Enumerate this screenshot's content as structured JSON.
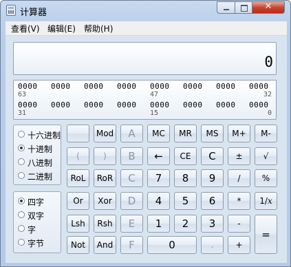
{
  "window": {
    "title": "计算器"
  },
  "menu": [
    "查看(V)",
    "编辑(E)",
    "帮助(H)"
  ],
  "display": {
    "value": "0"
  },
  "bits": {
    "rows": [
      [
        "0000",
        "0000",
        "0000",
        "0000",
        "0000",
        "0000",
        "0000",
        "0000"
      ],
      [
        "0000",
        "0000",
        "0000",
        "0000",
        "0000",
        "0000",
        "0000",
        "0000"
      ]
    ],
    "positions": [
      [
        "63",
        "47",
        "32"
      ],
      [
        "31",
        "15",
        "0"
      ]
    ]
  },
  "radix": {
    "options": [
      "十六进制",
      "十进制",
      "八进制",
      "二进制"
    ],
    "selected": 1
  },
  "word": {
    "options": [
      "四字",
      "双字",
      "字",
      "字节"
    ],
    "selected": 0
  },
  "keys": [
    [
      "",
      "Mod",
      "A",
      "MC",
      "MR",
      "MS",
      "M+",
      "M-"
    ],
    [
      "(",
      ")",
      "B",
      "←",
      "CE",
      "C",
      "±",
      "√"
    ],
    [
      "RoL",
      "RoR",
      "C",
      "7",
      "8",
      "9",
      "/",
      "%"
    ],
    [
      "Or",
      "Xor",
      "D",
      "4",
      "5",
      "6",
      "*",
      "1/x"
    ],
    [
      "Lsh",
      "Rsh",
      "E",
      "1",
      "2",
      "3",
      "-",
      "="
    ],
    [
      "Not",
      "And",
      "F",
      "0",
      ".",
      "+"
    ]
  ]
}
